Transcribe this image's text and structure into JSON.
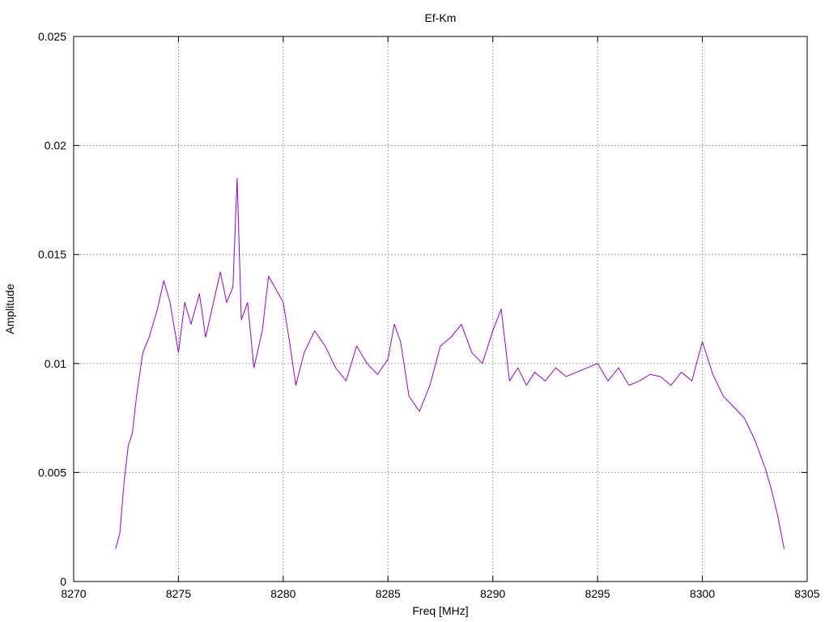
{
  "chart_data": {
    "type": "line",
    "title": "Ef-Km",
    "xlabel": "Freq [MHz]",
    "ylabel": "Amplitude",
    "xlim": [
      8270,
      8305
    ],
    "ylim": [
      0,
      0.025
    ],
    "x_ticks": [
      8270,
      8275,
      8280,
      8285,
      8290,
      8295,
      8300,
      8305
    ],
    "y_ticks": [
      0,
      0.005,
      0.01,
      0.015,
      0.02,
      0.025
    ],
    "x_tick_labels": [
      "8270",
      "8275",
      "8280",
      "8285",
      "8290",
      "8295",
      "8300",
      "8305"
    ],
    "y_tick_labels": [
      "0",
      "0.005",
      "0.01",
      "0.015",
      "0.02",
      "0.025"
    ],
    "grid": true,
    "series": [
      {
        "color": "#9400d3",
        "x": [
          8272.0,
          8272.2,
          8272.4,
          8272.6,
          8272.8,
          8273.0,
          8273.3,
          8273.6,
          8274.0,
          8274.3,
          8274.6,
          8275.0,
          8275.3,
          8275.6,
          8276.0,
          8276.3,
          8276.6,
          8277.0,
          8277.3,
          8277.6,
          8277.8,
          8278.0,
          8278.3,
          8278.6,
          8279.0,
          8279.3,
          8279.6,
          8280.0,
          8280.3,
          8280.6,
          8281.0,
          8281.5,
          8282.0,
          8282.5,
          8283.0,
          8283.5,
          8284.0,
          8284.5,
          8285.0,
          8285.3,
          8285.6,
          8286.0,
          8286.5,
          8287.0,
          8287.5,
          8288.0,
          8288.5,
          8289.0,
          8289.5,
          8290.0,
          8290.4,
          8290.8,
          8291.2,
          8291.6,
          8292.0,
          8292.5,
          8293.0,
          8293.5,
          8294.0,
          8294.5,
          8295.0,
          8295.5,
          8296.0,
          8296.5,
          8297.0,
          8297.5,
          8298.0,
          8298.5,
          8299.0,
          8299.5,
          8300.0,
          8300.5,
          8301.0,
          8301.5,
          8302.0,
          8302.5,
          8303.0,
          8303.3,
          8303.6,
          8303.9
        ],
        "y": [
          0.0015,
          0.0022,
          0.0045,
          0.0062,
          0.0068,
          0.0085,
          0.0105,
          0.0112,
          0.0125,
          0.0138,
          0.0128,
          0.0105,
          0.0128,
          0.0118,
          0.0132,
          0.0112,
          0.0125,
          0.0142,
          0.0128,
          0.0135,
          0.0185,
          0.012,
          0.0128,
          0.0098,
          0.0115,
          0.014,
          0.0135,
          0.0128,
          0.011,
          0.009,
          0.0105,
          0.0115,
          0.0108,
          0.0098,
          0.0092,
          0.0108,
          0.01,
          0.0095,
          0.0102,
          0.0118,
          0.011,
          0.0085,
          0.0078,
          0.009,
          0.0108,
          0.0112,
          0.0118,
          0.0105,
          0.01,
          0.0115,
          0.0125,
          0.0092,
          0.0098,
          0.009,
          0.0096,
          0.0092,
          0.0098,
          0.0094,
          0.0096,
          0.0098,
          0.01,
          0.0092,
          0.0098,
          0.009,
          0.0092,
          0.0095,
          0.0094,
          0.009,
          0.0096,
          0.0092,
          0.011,
          0.0095,
          0.0085,
          0.008,
          0.0075,
          0.0065,
          0.0052,
          0.0042,
          0.003,
          0.0015
        ]
      }
    ]
  }
}
